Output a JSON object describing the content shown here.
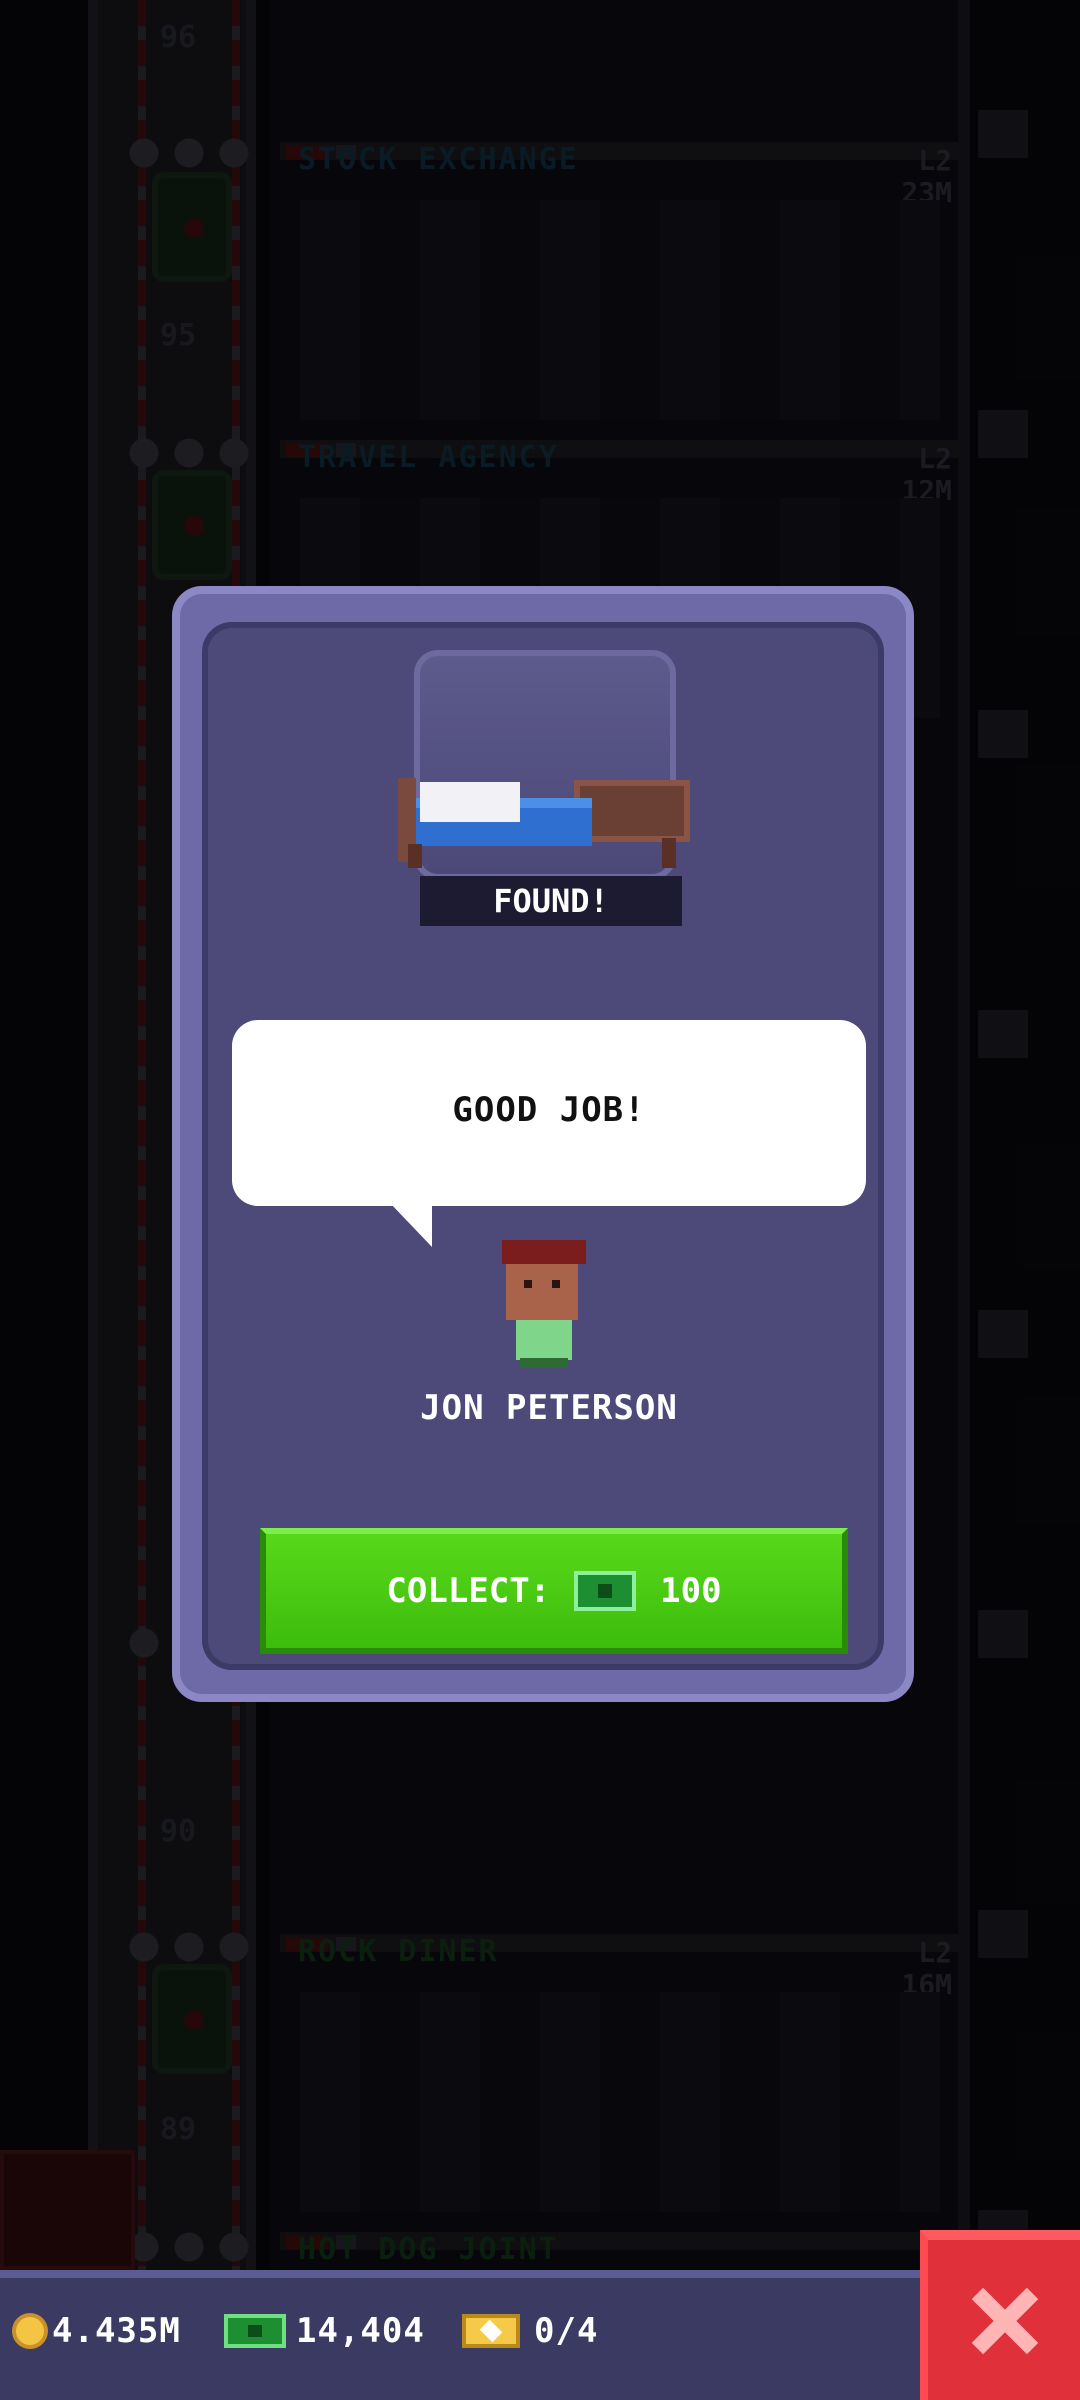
{
  "tower": {
    "floors": [
      {
        "name": "STOCK EXCHANGE",
        "level": "L2",
        "value": "23M",
        "shaft_number": "95",
        "color": "blue"
      },
      {
        "name": "TRAVEL AGENCY",
        "level": "L2",
        "value": "12M",
        "shaft_number": "",
        "color": "blue"
      },
      {
        "name": "ROCK DINER",
        "level": "L2",
        "value": "16M",
        "shaft_number": "89",
        "color": "green"
      },
      {
        "name": "HOT DOG JOINT",
        "level": "",
        "value": "",
        "shaft_number": "",
        "color": "green"
      }
    ],
    "top_shaft_number": "96",
    "shaft_number_90": "90"
  },
  "modal": {
    "found_label": "FOUND!",
    "item_icon": "bed-icon",
    "speech": "GOOD JOB!",
    "character_name": "JON PETERSON",
    "collect_label": "COLLECT:",
    "collect_amount": "100"
  },
  "status_bar": {
    "coins": "4.435M",
    "bux": "14,404",
    "tickets": "0/4"
  },
  "colors": {
    "modal_bg": "#4d4a7a",
    "collect_green": "#4cc914",
    "close_red": "#e0303a"
  }
}
